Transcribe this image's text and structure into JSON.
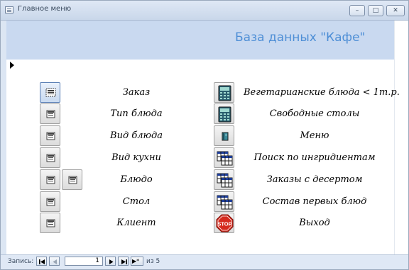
{
  "window": {
    "title": "Главное меню",
    "buttons": {
      "minimize": "–",
      "maximize": "□",
      "close": "✕"
    }
  },
  "form": {
    "header_title": "База данных \"Кафе\"",
    "left_column": [
      {
        "label": "Заказ",
        "icon": "form-icon"
      },
      {
        "label": "Тип блюда",
        "icon": "form-icon"
      },
      {
        "label": "Вид блюда",
        "icon": "form-icon"
      },
      {
        "label": "Вид кухни",
        "icon": "form-icon"
      },
      {
        "label": "Блюдо",
        "icon": "form-icon"
      },
      {
        "label": "Стол",
        "icon": "form-icon"
      },
      {
        "label": "Клиент",
        "icon": "form-icon"
      }
    ],
    "extra_button_icon": "form-icon",
    "right_column": [
      {
        "label": "Вегетарианские блюда < 1т.р.",
        "icon": "calculator-icon"
      },
      {
        "label": "Свободные столы",
        "icon": "calculator-icon"
      },
      {
        "label": "Меню",
        "icon": "book-icon"
      },
      {
        "label": "Поиск по ингридиентам",
        "icon": "query-grid-icon"
      },
      {
        "label": "Заказы с десертом",
        "icon": "query-grid-icon"
      },
      {
        "label": "Состав первых блюд",
        "icon": "query-grid-icon"
      },
      {
        "label": "Выход",
        "icon": "stop-sign-icon",
        "stop_text": "STOP"
      }
    ]
  },
  "navigation": {
    "label": "Запись:",
    "current": "1",
    "of_label": "из 5",
    "new_record_symbol": "▶*"
  },
  "colors": {
    "header_band": "#c9d9f0",
    "header_text": "#4f8fd6",
    "stop_red": "#d52b1e"
  }
}
